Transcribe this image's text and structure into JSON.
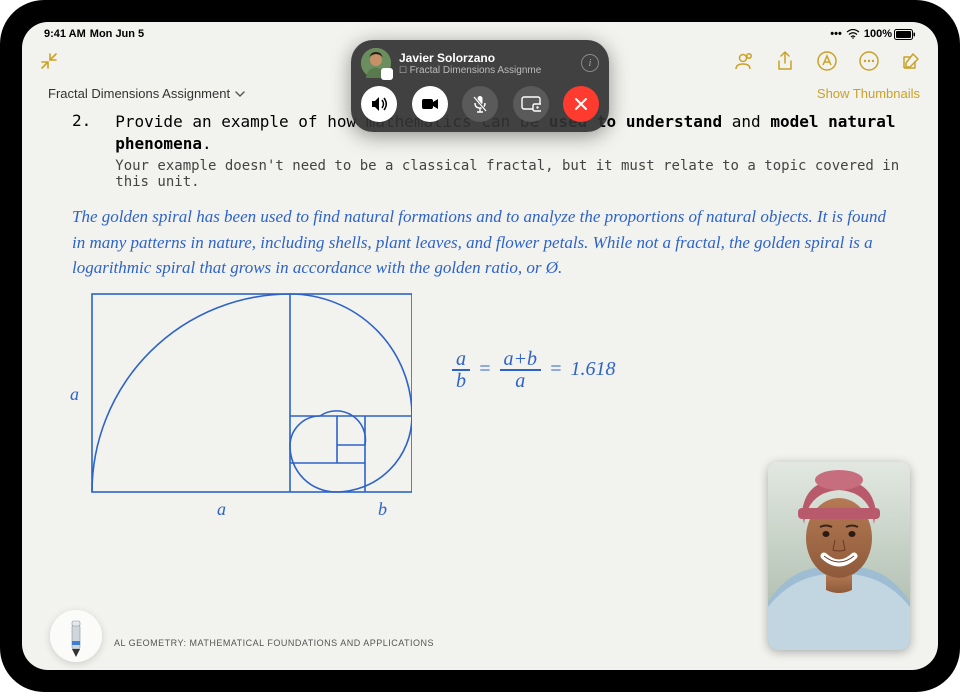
{
  "status": {
    "time": "9:41 AM",
    "date": "Mon Jun 5",
    "battery_pct": "100%"
  },
  "toolbar": {
    "note_title": "Fractal Dimensions Assignment",
    "show_thumbnails": "Show Thumbnails"
  },
  "question": {
    "number": "2.",
    "prompt_a": "Provide an example of how mathematics can be ",
    "prompt_b_bold": "used to understand",
    "prompt_c": " and ",
    "prompt_d_bold": "model natural phenomena",
    "prompt_e": ".",
    "sub": "Your example doesn't need to be a classical fractal, but it must relate to a topic covered in this unit."
  },
  "handwriting": "The golden spiral has been used to find natural formations and to analyze the proportions of natural objects. It is found in many patterns in nature, including shells, plant leaves, and flower petals. While not a fractal, the golden spiral is a logarithmic spiral that grows in accordance with the golden ratio, or Ø.",
  "diagram": {
    "label_left": "a",
    "label_bottom_a": "a",
    "label_bottom_b": "b"
  },
  "equation": {
    "frac1_top": "a",
    "frac1_bot": "b",
    "eq1": "=",
    "frac2_top": "a+b",
    "frac2_bot": "a",
    "eq2": "=",
    "value": "1.618"
  },
  "footer": "AL GEOMETRY: MATHEMATICAL FOUNDATIONS AND APPLICATIONS",
  "call": {
    "name": "Javier Solorzano",
    "sub": "Fractal Dimensions Assignme"
  }
}
